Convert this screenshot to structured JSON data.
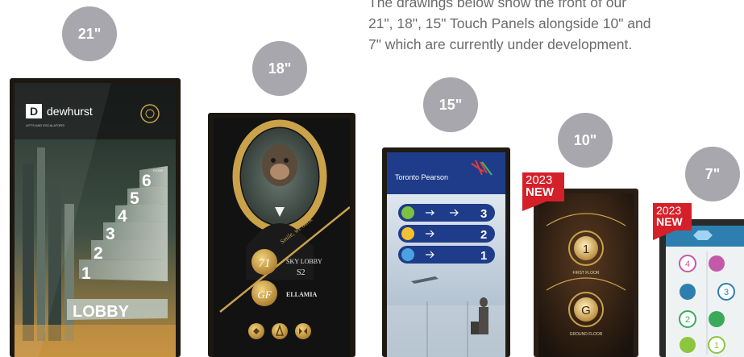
{
  "intro": {
    "line1": "The drawings below show the front of our",
    "line2": "21\", 18\", 15\" Touch Panels alongside 10\" and",
    "line3": "7\" which are currently under development."
  },
  "sizes": {
    "s21": "21\"",
    "s18": "18\"",
    "s15": "15\"",
    "s10": "10\"",
    "s7": "7\""
  },
  "tags": {
    "year": "2023",
    "label": "NEW"
  },
  "panel21": {
    "brand": "dewhurst",
    "brand_sub": "LIFTS AND ESCALATORS",
    "floors": [
      "6",
      "5",
      "4",
      "3",
      "2",
      "1"
    ],
    "floor_caption": "FLOOR",
    "lobby": "LOBBY"
  },
  "panel18": {
    "tagline": "Smile, we bank",
    "floor_main": "71",
    "floor_label": "SKY LOBBY",
    "floor_sub": "S2",
    "floor_gf": "GF",
    "gf_label": "ELLAMIA"
  },
  "panel15": {
    "brand": "Toronto Pearson",
    "rows": [
      "3",
      "2",
      "1"
    ]
  },
  "panel10": {
    "floor_top": "1",
    "label_top": "FIRST FLOOR",
    "floor_bottom": "G",
    "label_bottom": "GROUND FLOOR"
  },
  "panel7": {
    "numbers": [
      "4",
      "3",
      "2",
      "1"
    ]
  },
  "colors": {
    "badge": "#a7a7ad",
    "tag": "#d5202a",
    "frame": "#1c1711",
    "gold": "#c9a24a"
  }
}
